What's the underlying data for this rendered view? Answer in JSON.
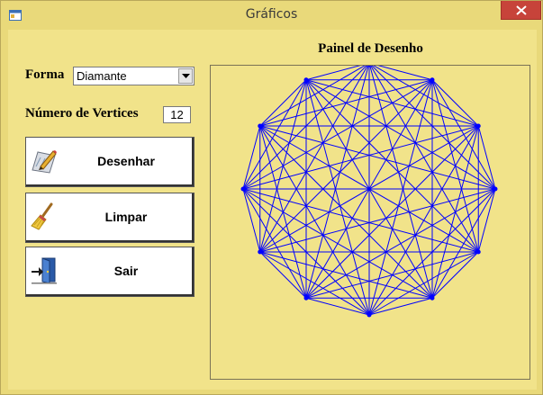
{
  "window": {
    "title": "Gráficos"
  },
  "form": {
    "shape_label": "Forma",
    "shape_value": "Diamante",
    "vertices_label": "Número de Vertices",
    "vertices_value": "12"
  },
  "buttons": {
    "draw": "Desenhar",
    "clear": "Limpar",
    "exit": "Sair"
  },
  "panel": {
    "title": "Painel de Desenho",
    "line_color": "#0000ff",
    "vertex_count": 12,
    "shape": "complete-graph"
  },
  "colors": {
    "background": "#f1e38a",
    "close_button": "#c7433a"
  },
  "icons": {
    "app": "window-icon",
    "close": "close-icon",
    "dropdown": "chevron-down-icon",
    "draw": "drawing-pencil-icon",
    "clear": "broom-icon",
    "exit": "exit-door-icon"
  }
}
